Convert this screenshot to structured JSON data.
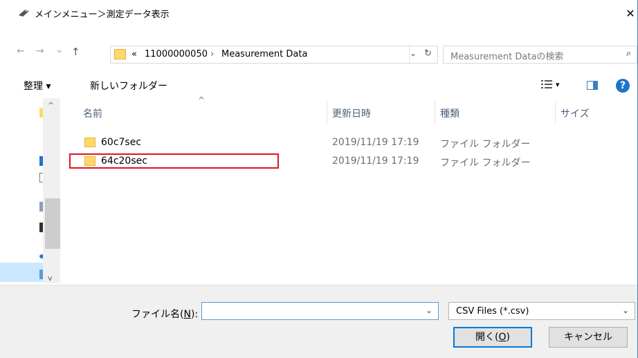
{
  "titlebar": {
    "title": "メインメニュー＞測定データ表示",
    "close": "✕"
  },
  "nav": {
    "back": "←",
    "forward": "→",
    "recent": "⌄",
    "up": "↑",
    "breadcrumb_prefix": "«",
    "crumb1": "11000000050",
    "sep": "›",
    "crumb2": "Measurement Data",
    "dropdown": "⌄",
    "refresh": "↻"
  },
  "search": {
    "placeholder": "Measurement Dataの検索",
    "icon": "⌕"
  },
  "toolbar": {
    "organize": "整理 ▾",
    "new_folder": "新しいフォルダー",
    "view_dd": "▾",
    "help": "?"
  },
  "columns": {
    "name": "名前",
    "date": "更新日時",
    "type": "種類",
    "size": "サイズ",
    "sort": "^"
  },
  "files": [
    {
      "name": "60c7sec",
      "date": "2019/11/19 17:19",
      "type": "ファイル フォルダー"
    },
    {
      "name": "64c20sec",
      "date": "2019/11/19 17:19",
      "type": "ファイル フォルダー"
    }
  ],
  "bottom": {
    "filename_label_pre": "ファイル名(",
    "filename_label_key": "N",
    "filename_label_post": "):",
    "filename_value": "",
    "filetype": "CSV Files (*.csv)",
    "open_pre": "開く(",
    "open_key": "O",
    "open_post": ")",
    "cancel": "キャンセル"
  },
  "colors": {
    "accent": "#0078d7",
    "folder": "#ffd867",
    "highlight": "#e0141e"
  }
}
